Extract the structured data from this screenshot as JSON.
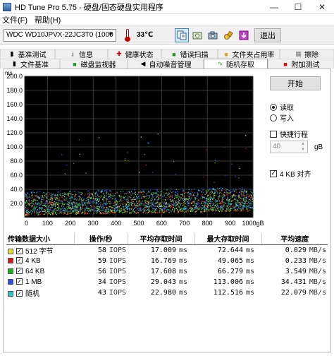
{
  "window": {
    "title": "HD Tune Pro 5.75 - 硬盘/固态硬盘实用程序",
    "min": "—",
    "max": "☐",
    "close": "✕"
  },
  "menu": [
    "文件(F)",
    "帮助(H)"
  ],
  "toolbar": {
    "drive": "WDC WD10JPVX-22JC3T0 (1000 gB)",
    "temperature": "33℃",
    "exit_label": "退出"
  },
  "tabs_row1": [
    "基准测试",
    "信息",
    "健康状态",
    "错误扫描",
    "文件夹占用率",
    "擦除"
  ],
  "tabs_row2": [
    "文件基准",
    "磁盘监视器",
    "自动噪音管理",
    "随机存取",
    "附加测试"
  ],
  "active_tab": "随机存取",
  "controls": {
    "start_label": "开始",
    "read_label": "读取",
    "write_label": "写入",
    "mode": "read",
    "quick_label": "快捷行程",
    "quick_checked": false,
    "quick_value": "40",
    "quick_unit": "gB",
    "align_label": "4 KB 对齐",
    "align_checked": true
  },
  "chart_data": {
    "type": "scatter",
    "y_unit": "ms",
    "x_unit": "gB",
    "xlim": [
      0,
      1000
    ],
    "ylim": [
      0,
      200
    ],
    "y_ticks": [
      "200.0",
      "180.0",
      "160.0",
      "140.0",
      "120.0",
      "100.0",
      "80.0",
      "60.0",
      "40.0",
      "20.0"
    ],
    "x_ticks": [
      "0",
      "100",
      "200",
      "300",
      "400",
      "500",
      "600",
      "700",
      "800",
      "900",
      "1000gB"
    ],
    "grid": true,
    "series": [
      {
        "name": "512 字节",
        "color": "#f0e030",
        "range": [
          4,
          34
        ]
      },
      {
        "name": "4 KB",
        "color": "#d81818",
        "range": [
          4,
          34
        ]
      },
      {
        "name": "64 KB",
        "color": "#18b818",
        "range": [
          5,
          35
        ]
      },
      {
        "name": "1 MB",
        "color": "#2850e8",
        "range": [
          8,
          38
        ]
      },
      {
        "name": "随机",
        "color": "#28c8d8",
        "range": [
          7,
          37
        ]
      }
    ]
  },
  "results": {
    "headers": [
      "传输数据大小",
      "操作/秒",
      "平均存取时间",
      "最大存取时间",
      "平均速度"
    ],
    "rows": [
      {
        "label": "512 字节",
        "color": "#f0e030",
        "checked": true,
        "ops": "58",
        "ops_unit": "IOPS",
        "avg": "17.009",
        "avg_unit": "ms",
        "max": "72.644",
        "max_unit": "ms",
        "speed": "0.029",
        "speed_unit": "MB/s"
      },
      {
        "label": "4 KB",
        "color": "#d81818",
        "checked": true,
        "ops": "59",
        "ops_unit": "IOPS",
        "avg": "16.769",
        "avg_unit": "ms",
        "max": "49.065",
        "max_unit": "ms",
        "speed": "0.233",
        "speed_unit": "MB/s"
      },
      {
        "label": "64 KB",
        "color": "#18b818",
        "checked": true,
        "ops": "56",
        "ops_unit": "IOPS",
        "avg": "17.608",
        "avg_unit": "ms",
        "max": "66.279",
        "max_unit": "ms",
        "speed": "3.549",
        "speed_unit": "MB/s"
      },
      {
        "label": "1 MB",
        "color": "#2850e8",
        "checked": true,
        "ops": "34",
        "ops_unit": "IOPS",
        "avg": "29.043",
        "avg_unit": "ms",
        "max": "113.006",
        "max_unit": "ms",
        "speed": "34.431",
        "speed_unit": "MB/s"
      },
      {
        "label": "随机",
        "color": "#28c8d8",
        "checked": true,
        "ops": "43",
        "ops_unit": "IOPS",
        "avg": "22.980",
        "avg_unit": "ms",
        "max": "112.516",
        "max_unit": "ms",
        "speed": "22.079",
        "speed_unit": "MB/s"
      }
    ]
  }
}
